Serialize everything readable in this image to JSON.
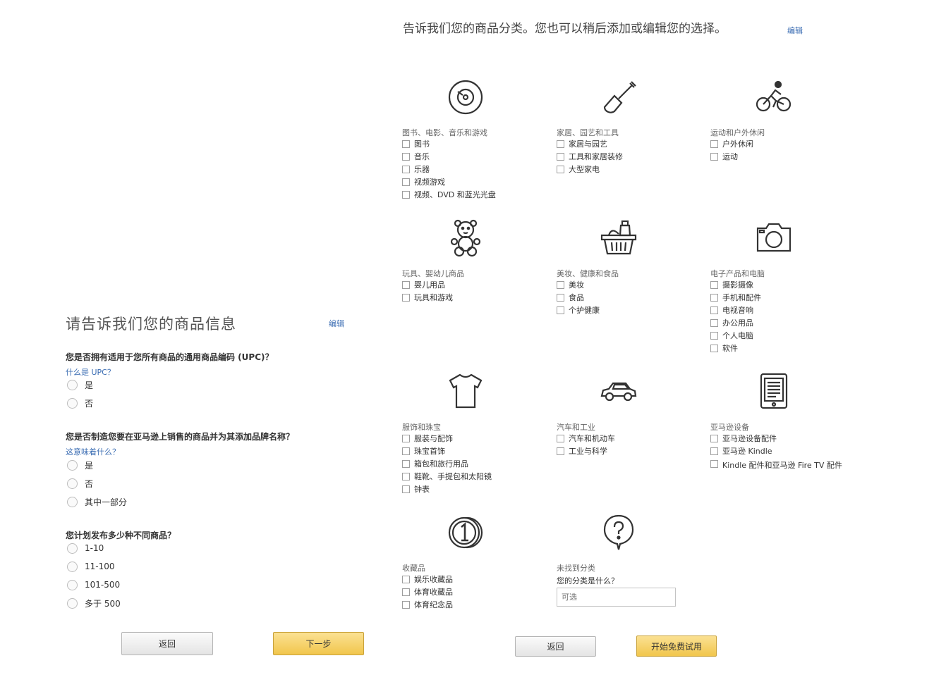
{
  "left": {
    "title": "请告诉我们您的商品信息",
    "edit_link": "编辑",
    "questions": [
      {
        "text": "您是否拥有适用于您所有商品的通用商品编码 (UPC)？",
        "link": "什么是 UPC？",
        "options": [
          "是",
          "否"
        ]
      },
      {
        "text": "您是否制造您要在亚马逊上销售的商品并为其添加品牌名称？",
        "link": "这意味着什么？",
        "options": [
          "是",
          "否",
          "其中一部分"
        ]
      },
      {
        "text": "您计划发布多少种不同商品？",
        "options": [
          "1-10",
          "11-100",
          "101-500",
          "多于 500"
        ]
      }
    ],
    "back_button": "返回",
    "next_button": "下一步"
  },
  "right": {
    "title": "告诉我们您的商品分类。您也可以稍后添加或编辑您的选择。",
    "edit_link": "编辑",
    "categories": [
      {
        "icon": "disc-icon",
        "title": "图书、电影、音乐和游戏",
        "items": [
          "图书",
          "音乐",
          "乐器",
          "视频游戏",
          "视频、DVD 和蓝光光盘"
        ]
      },
      {
        "icon": "shovel-icon",
        "title": "家居、园艺和工具",
        "items": [
          "家居与园艺",
          "工具和家居装修",
          "大型家电"
        ]
      },
      {
        "icon": "cyclist-icon",
        "title": "运动和户外休闲",
        "items": [
          "户外休闲",
          "运动"
        ]
      },
      {
        "icon": "teddy-bear-icon",
        "title": "玩具、婴幼儿商品",
        "items": [
          "婴儿用品",
          "玩具和游戏"
        ]
      },
      {
        "icon": "grocery-basket-icon",
        "title": "美妆、健康和食品",
        "items": [
          "美妆",
          "食品",
          "个护健康"
        ]
      },
      {
        "icon": "camera-icon",
        "title": "电子产品和电脑",
        "items": [
          "摄影摄像",
          "手机和配件",
          "电视音响",
          "办公用品",
          "个人电脑",
          "软件"
        ]
      },
      {
        "icon": "tshirt-icon",
        "title": "服饰和珠宝",
        "items": [
          "服装与配饰",
          "珠宝首饰",
          "箱包和旅行用品",
          "鞋靴、手提包和太阳镜",
          "钟表"
        ]
      },
      {
        "icon": "car-icon",
        "title": "汽车和工业",
        "items": [
          "汽车和机动车",
          "工业与科学"
        ]
      },
      {
        "icon": "ereader-icon",
        "title": "亚马逊设备",
        "items": [
          "亚马逊设备配件",
          "亚马逊 Kindle",
          "Kindle 配件和亚马逊 Fire TV 配件"
        ]
      },
      {
        "icon": "coin-icon",
        "title": "收藏品",
        "items": [
          "娱乐收藏品",
          "体育收藏品",
          "体育纪念品"
        ]
      },
      {
        "icon": "question-icon",
        "title": "未找到分类",
        "sub": "您的分类是什么？",
        "input_placeholder": "可选"
      }
    ],
    "back_button": "返回",
    "start_button": "开始免费试用"
  }
}
